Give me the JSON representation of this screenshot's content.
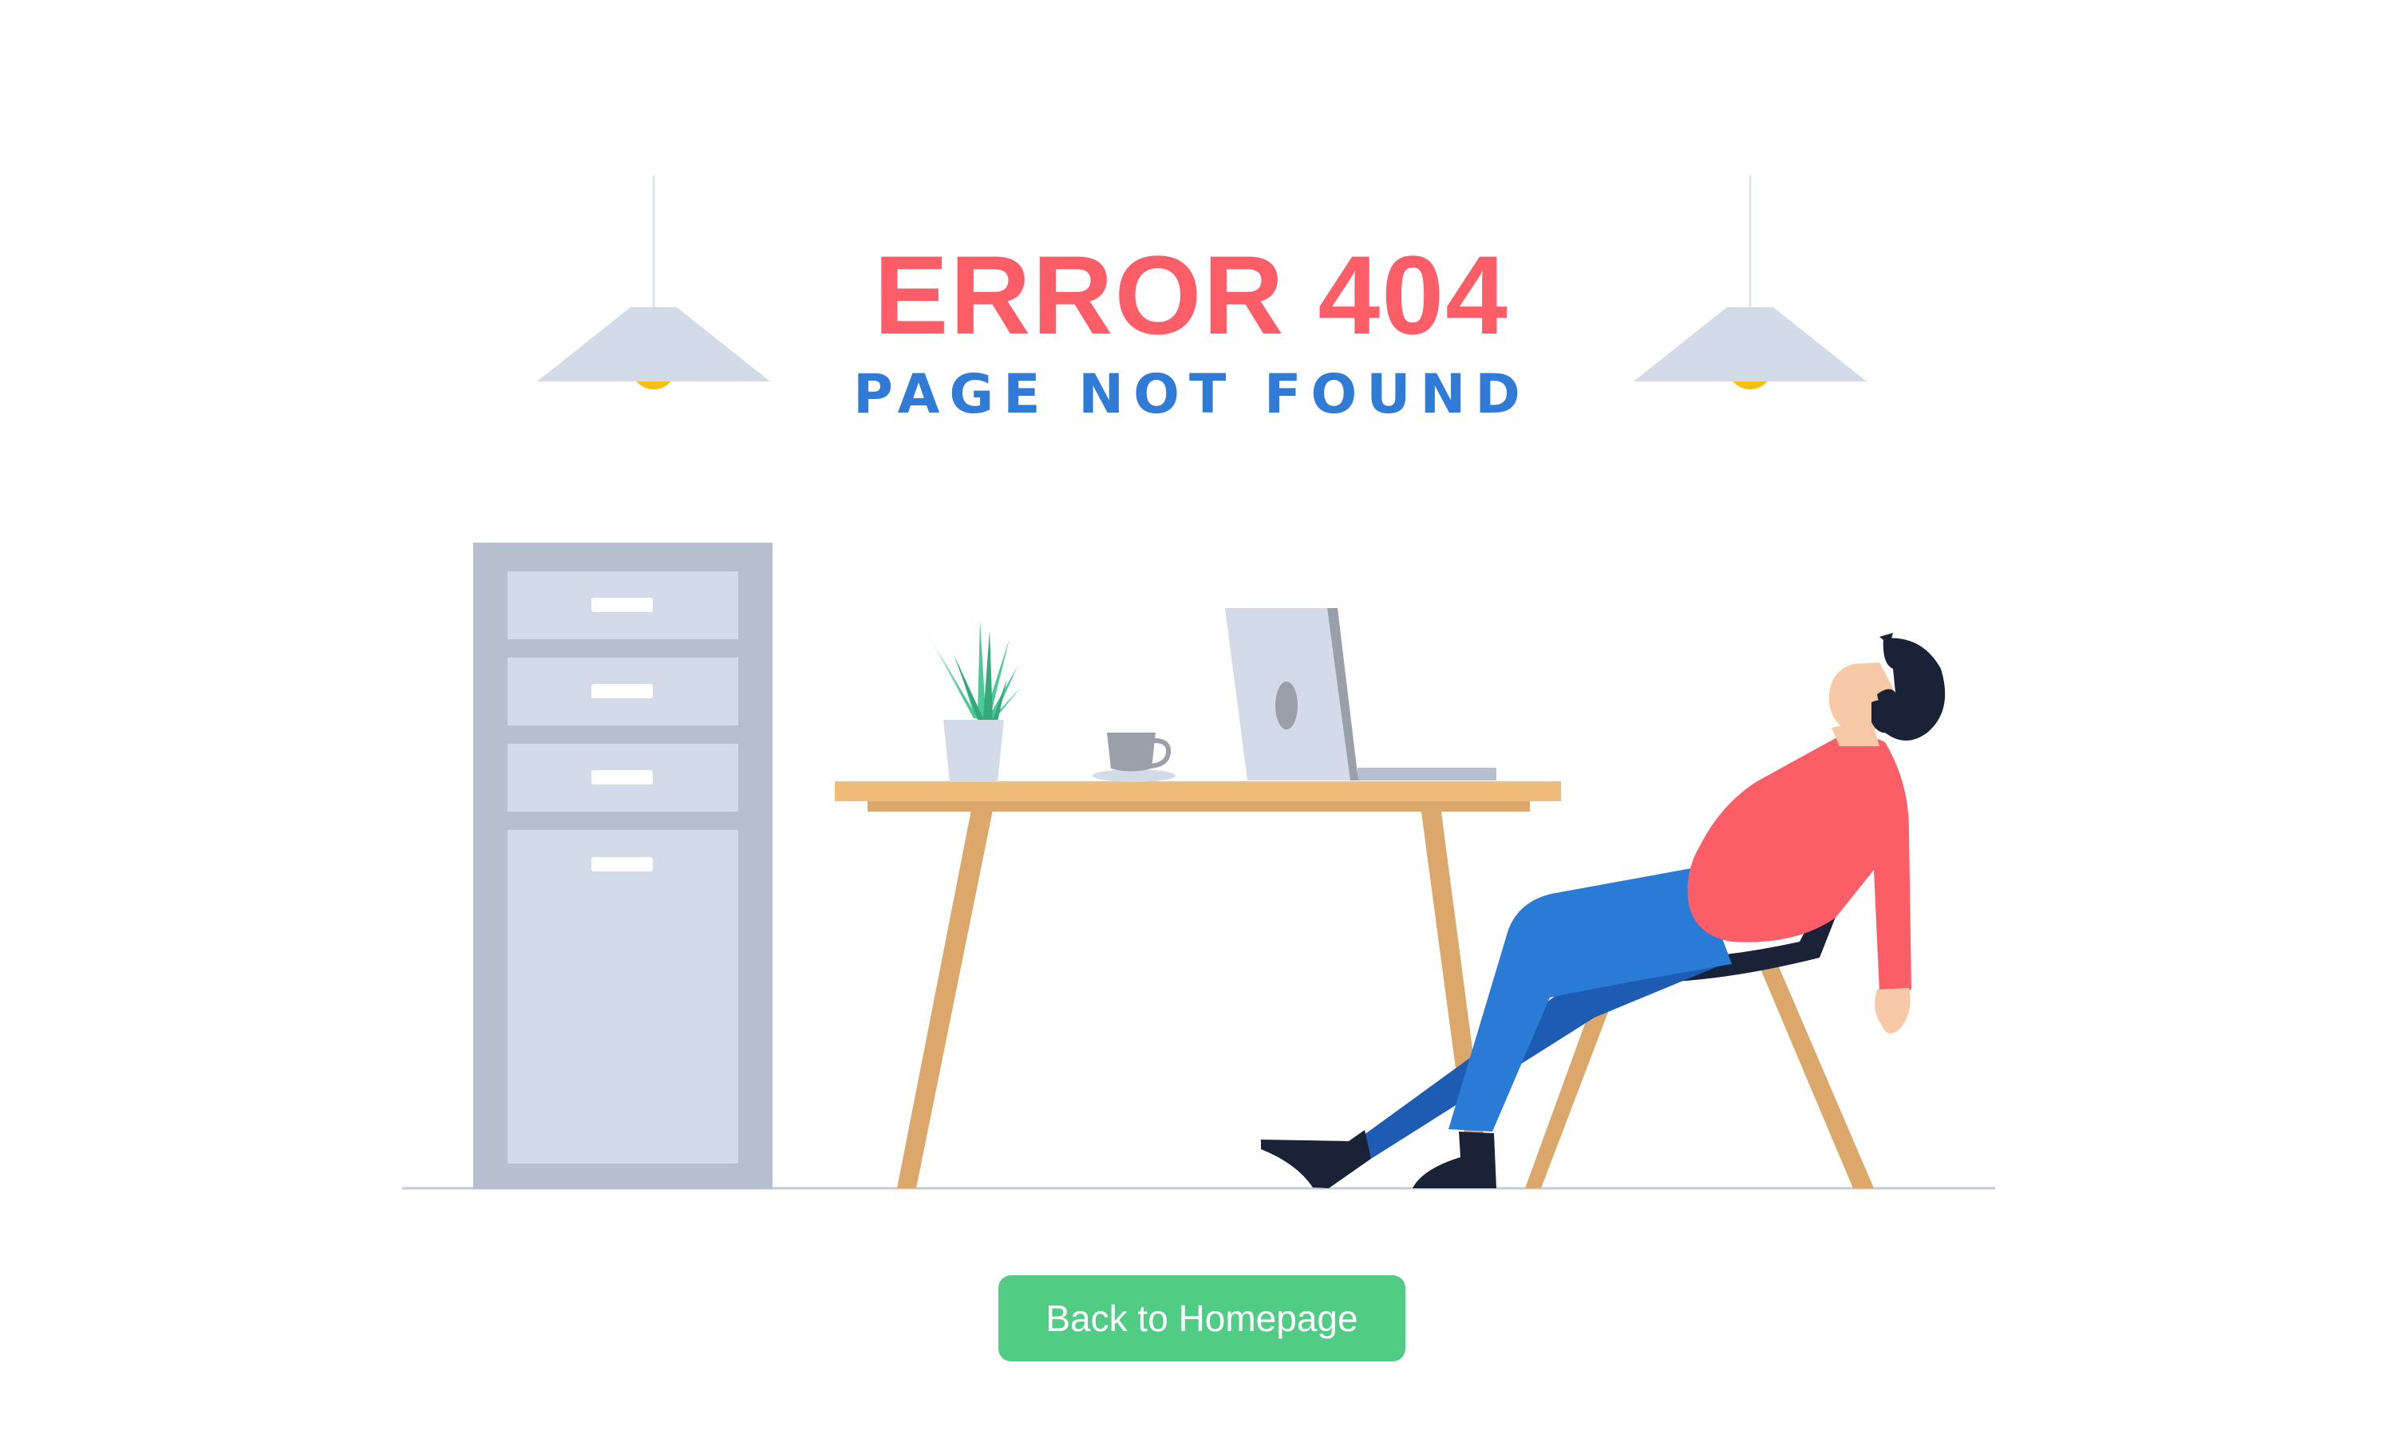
{
  "header": {
    "title": "ERROR 404",
    "subtitle": "PAGE NOT FOUND"
  },
  "actions": {
    "home_button_label": "Back to Homepage"
  },
  "colors": {
    "title": "#fc5e68",
    "subtitle": "#2f7bd6",
    "button": "#50cc84",
    "lamp_shade": "#d3dbe9",
    "lamp_bulb": "#f7be16",
    "cabinet_frame": "#b6bfcd",
    "cabinet_drawer": "#d3dbe9",
    "desk_top": "#efbd79",
    "desk_legs": "#dba76a",
    "shirt": "#fc5e68",
    "pants": "#2a7bd6",
    "hair": "#1a2238",
    "skin": "#f8c9a6",
    "plant": "#4cc995"
  },
  "illustration": {
    "icons": [
      "pendant-lamp-icon",
      "filing-cabinet-icon",
      "desk-icon",
      "plant-icon",
      "coffee-cup-icon",
      "laptop-icon",
      "sleeping-man-icon",
      "chair-icon"
    ]
  }
}
